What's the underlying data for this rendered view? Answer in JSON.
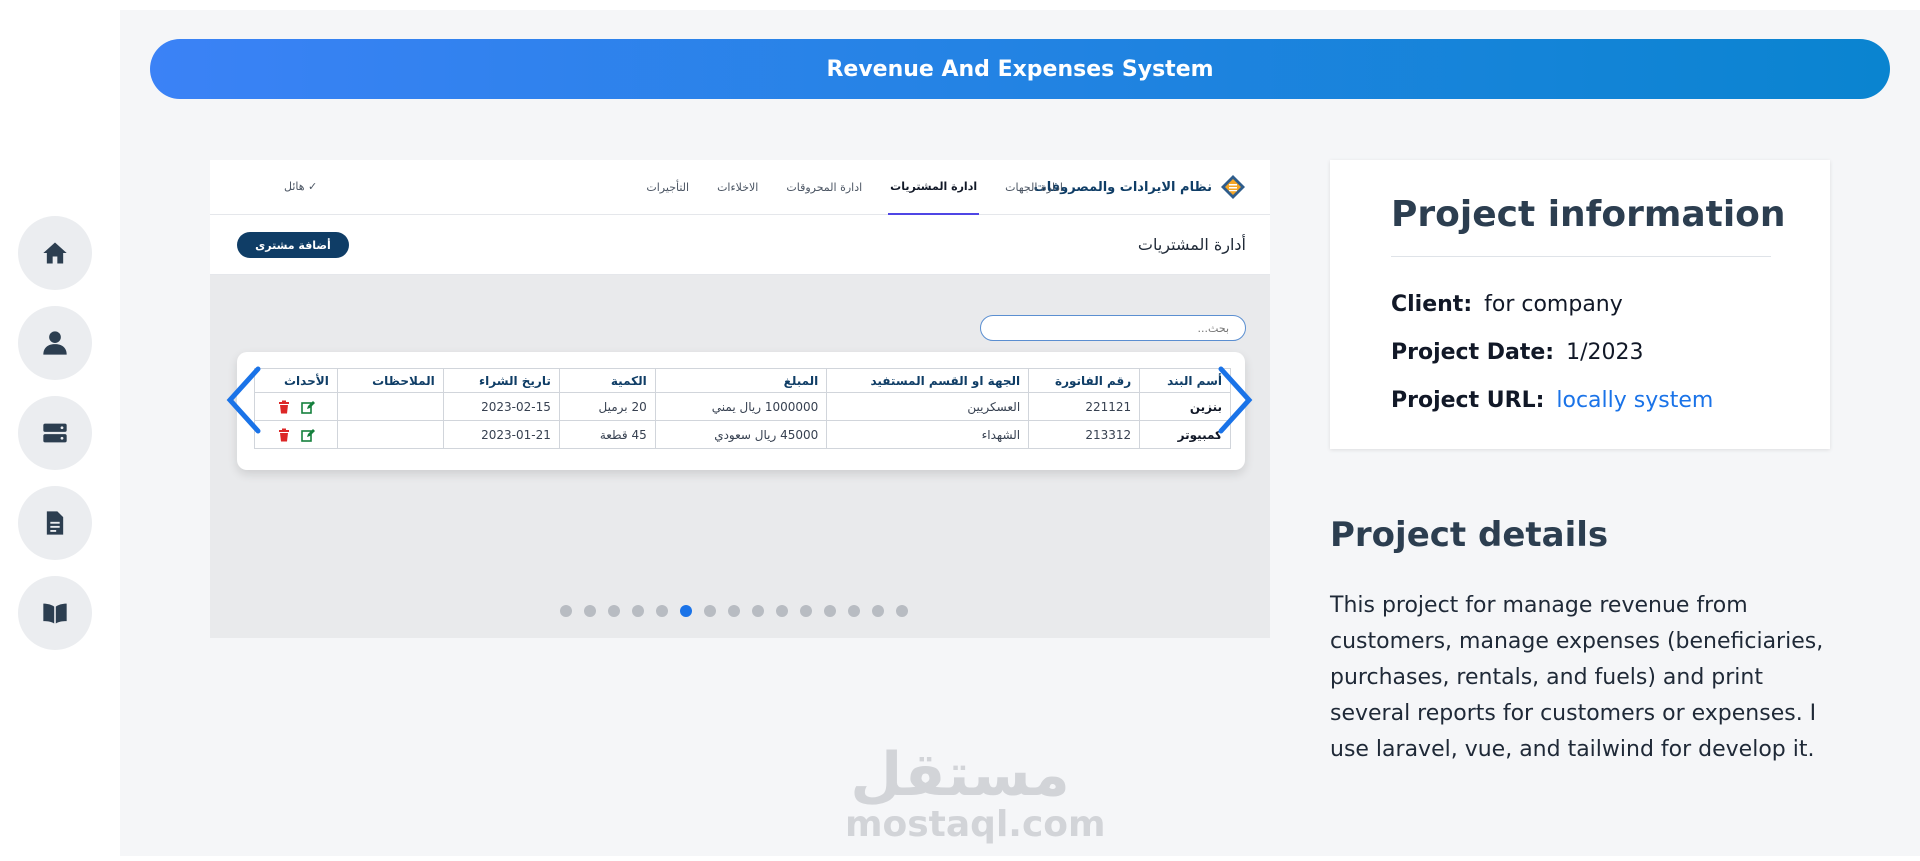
{
  "banner": {
    "title": "Revenue And Expenses System"
  },
  "rail": {
    "items": [
      {
        "name": "home",
        "icon": "home-icon"
      },
      {
        "name": "profile",
        "icon": "user-icon"
      },
      {
        "name": "services",
        "icon": "server-icon"
      },
      {
        "name": "resume",
        "icon": "document-icon"
      },
      {
        "name": "portfolio",
        "icon": "book-icon"
      }
    ]
  },
  "screenshot": {
    "brand": "نظام الايرادات والمصروفات",
    "nav": [
      "ادارة الجهات",
      "ادارة المشتريات",
      "ادارة المحروقات",
      "الاخلاءات",
      "التأجيرات"
    ],
    "active_nav": "ادارة المشتريات",
    "user": "هائل",
    "page_title": "أدارة المشتريات",
    "add_button": "أضافة مشترى",
    "search_placeholder": "بحث...",
    "table": {
      "headers": [
        "أسم البند",
        "رقم الفاتورة",
        "الجهة او القسم المستفيد",
        "المبلغ",
        "الكمية",
        "تاريخ الشراء",
        "الملاحظات",
        "الأحداث"
      ],
      "rows": [
        [
          "بنزين",
          "221121",
          "العسكريين",
          "1000000 ريال يمني",
          "20 برميل",
          "2023-02-15",
          ""
        ],
        [
          "كمبيوتر",
          "213312",
          "الشهداء",
          "45000 ريال سعودي",
          "45 قطعة",
          "2023-01-21",
          ""
        ]
      ]
    }
  },
  "carousel": {
    "total_slides": 15,
    "active_index": 5
  },
  "project_info": {
    "title": "Project information",
    "client_label": "Client:",
    "client_value": "for company",
    "date_label": "Project Date:",
    "date_value": "1/2023",
    "url_label": "Project URL:",
    "url_value": "locally system"
  },
  "project_details": {
    "title": "Project details",
    "text": "This project for manage revenue from customers, manage expenses (beneficiaries, purchases, rentals, and fuels) and print several reports for customers or expenses. I use laravel, vue, and tailwind for develop it."
  },
  "watermark": {
    "arabic": "مستقل",
    "latin": "mostaql.com"
  },
  "colors": {
    "accent": "#1a73e8",
    "banner_start": "#3b82f6",
    "banner_end": "#0a84d0",
    "navy": "#0f3d66"
  }
}
